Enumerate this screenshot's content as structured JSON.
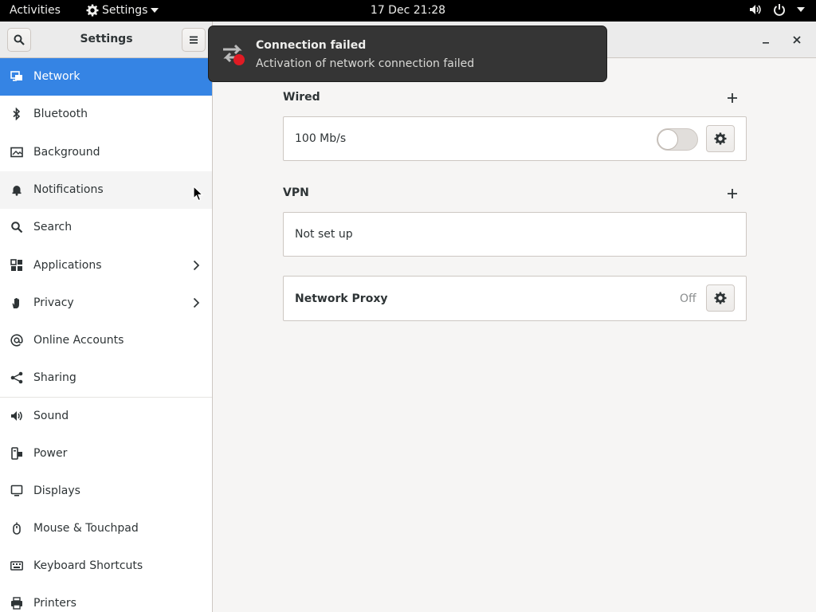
{
  "topbar": {
    "activities": "Activities",
    "app_menu": "Settings",
    "clock": "17 Dec  21:28",
    "icons": [
      "gear-icon",
      "volume-icon",
      "power-icon",
      "chevron-down-icon"
    ]
  },
  "headerbar": {
    "title": "Settings",
    "icons": [
      "search-icon",
      "menu-icon",
      "minimize-icon",
      "close-icon"
    ]
  },
  "sidebar": {
    "items": [
      {
        "label": "Network",
        "icon": "network-icon",
        "active": true
      },
      {
        "label": "Bluetooth",
        "icon": "bluetooth-icon"
      },
      {
        "label": "Background",
        "icon": "background-icon"
      },
      {
        "label": "Notifications",
        "icon": "bell-icon"
      },
      {
        "label": "Search",
        "icon": "search-icon"
      },
      {
        "label": "Applications",
        "icon": "apps-grid-icon",
        "has_submenu": true
      },
      {
        "label": "Privacy",
        "icon": "hand-icon",
        "has_submenu": true
      },
      {
        "label": "Online Accounts",
        "icon": "at-icon"
      },
      {
        "label": "Sharing",
        "icon": "share-icon"
      },
      {
        "label": "Sound",
        "icon": "speaker-icon"
      },
      {
        "label": "Power",
        "icon": "power-plug-icon"
      },
      {
        "label": "Displays",
        "icon": "display-icon"
      },
      {
        "label": "Mouse & Touchpad",
        "icon": "mouse-icon"
      },
      {
        "label": "Keyboard Shortcuts",
        "icon": "keyboard-icon"
      },
      {
        "label": "Printers",
        "icon": "printer-icon"
      }
    ]
  },
  "network": {
    "wired": {
      "title": "Wired",
      "speed": "100 Mb/s",
      "enabled": false
    },
    "vpn": {
      "title": "VPN",
      "status": "Not set up"
    },
    "proxy": {
      "label": "Network Proxy",
      "status": "Off"
    }
  },
  "notification": {
    "title": "Connection failed",
    "body": "Activation of network connection failed",
    "icon": "network-error-icon"
  },
  "colors": {
    "accent": "#3584e4",
    "topbar": "#000000",
    "notification_bg": "#353535",
    "error": "#e01b24"
  }
}
